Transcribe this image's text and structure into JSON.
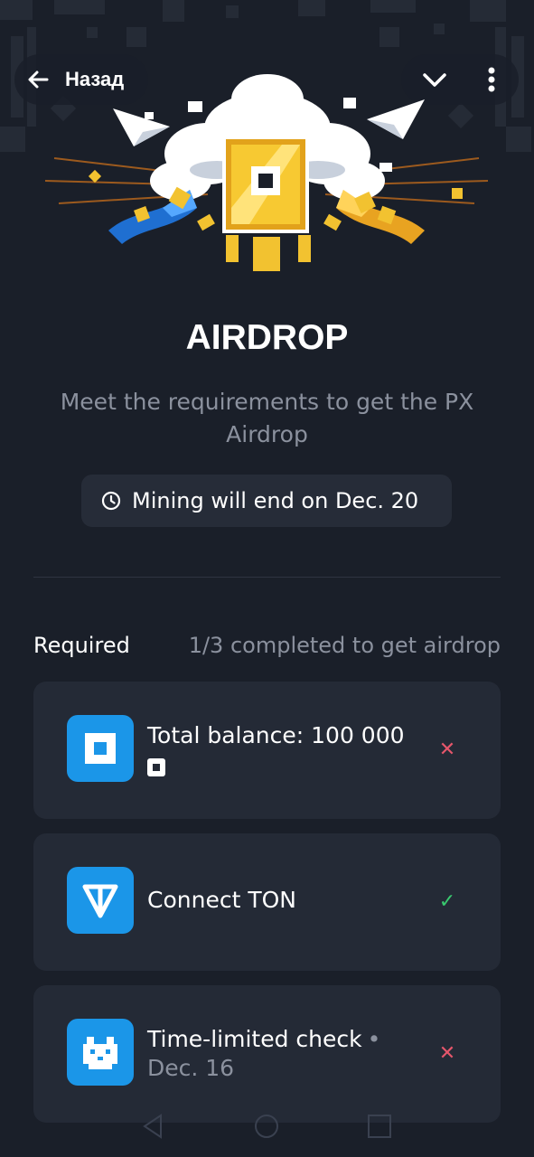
{
  "header": {
    "back_label": "Назад"
  },
  "hero": {
    "title": "AIRDROP",
    "subtitle": "Meet the requirements to get the PX Airdrop",
    "mining_notice": "Mining will end on Dec. 20"
  },
  "requirements": {
    "label": "Required",
    "progress": "1/3 completed to get airdrop",
    "items": [
      {
        "title": "Total balance: 100 000",
        "icon": "px-square-icon",
        "status": "not-completed"
      },
      {
        "title": "Connect TON",
        "icon": "ton-icon",
        "status": "completed"
      },
      {
        "title": "Time-limited check",
        "subtitle": "Dec. 16",
        "icon": "pixel-dog-icon",
        "status": "not-completed"
      }
    ]
  },
  "colors": {
    "background": "#1a1f29",
    "card": "#242a36",
    "accent_blue": "#1b96e8",
    "muted_text": "#8b919e",
    "error": "#e5566b",
    "success": "#39c96f",
    "gold": "#f2c230"
  }
}
